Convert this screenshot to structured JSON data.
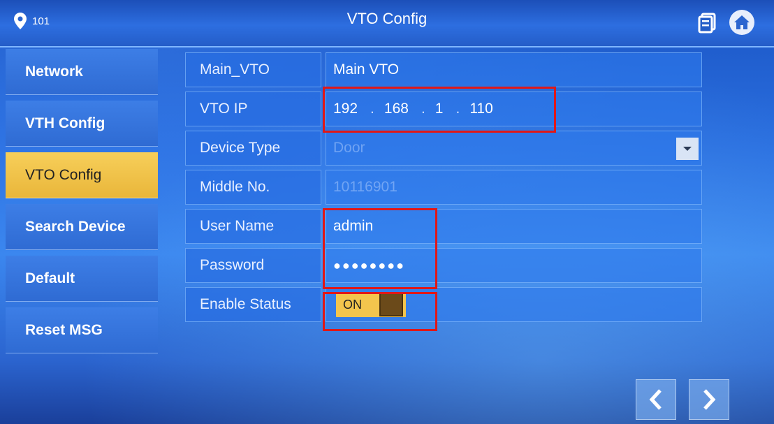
{
  "header": {
    "room": "101",
    "title": "VTO Config"
  },
  "sidebar": {
    "items": [
      {
        "label": "Network",
        "active": false
      },
      {
        "label": "VTH Config",
        "active": false
      },
      {
        "label": "VTO Config",
        "active": true
      },
      {
        "label": "Search Device",
        "active": false
      },
      {
        "label": "Default",
        "active": false
      },
      {
        "label": "Reset MSG",
        "active": false
      }
    ]
  },
  "form": {
    "main_vto": {
      "label": "Main_VTO",
      "value": "Main VTO"
    },
    "vto_ip": {
      "label": "VTO IP",
      "octets": [
        "192",
        "168",
        "1",
        "110"
      ]
    },
    "device_type": {
      "label": "Device Type",
      "value": "Door"
    },
    "middle_no": {
      "label": "Middle No.",
      "value": "10116901"
    },
    "user_name": {
      "label": "User Name",
      "value": "admin"
    },
    "password": {
      "label": "Password",
      "value": "●●●●●●●●"
    },
    "enable_status": {
      "label": "Enable Status",
      "value": "ON"
    }
  },
  "colors": {
    "active_tab": "#f0c24a",
    "highlight_box": "#e01818",
    "toggle_knob": "#6b4a1a"
  },
  "icons": {
    "location": "location-pin-icon",
    "message": "message-icon",
    "home": "home-icon",
    "dropdown": "chevron-down-icon",
    "prev": "chevron-left-icon",
    "next": "chevron-right-icon"
  }
}
